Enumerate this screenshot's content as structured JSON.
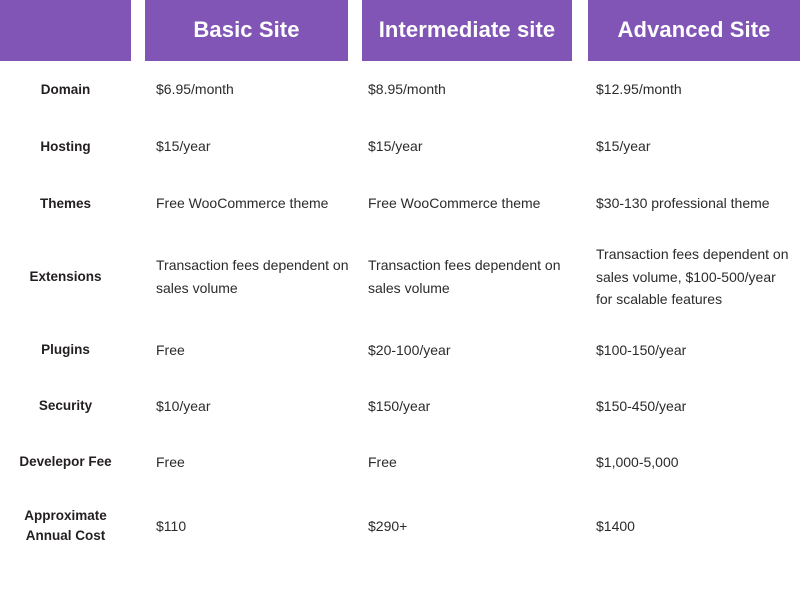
{
  "table": {
    "accent_color": "#8055b5",
    "header_text_color": "#ffffff",
    "body_text_color": "#2b2b2b",
    "columns": [
      {
        "label": ""
      },
      {
        "label": "Basic Site"
      },
      {
        "label": "Intermediate site"
      },
      {
        "label": "Advanced Site"
      }
    ],
    "rows": [
      {
        "label": "Domain",
        "values": [
          "$6.95/month",
          "$8.95/month",
          "$12.95/month"
        ]
      },
      {
        "label": "Hosting",
        "values": [
          "$15/year",
          "$15/year",
          "$15/year"
        ]
      },
      {
        "label": "Themes",
        "values": [
          "Free WooCommerce theme",
          "Free WooCommerce theme",
          "$30-130 professional theme"
        ]
      },
      {
        "label": "Extensions",
        "values": [
          "Transaction fees dependent on sales volume",
          "Transaction fees dependent on sales volume",
          "Transaction fees dependent on sales volume, $100-500/year for scalable features"
        ]
      },
      {
        "label": "Plugins",
        "values": [
          "Free",
          "$20-100/year",
          "$100-150/year"
        ]
      },
      {
        "label": "Security",
        "values": [
          "$10/year",
          "$150/year",
          "$150-450/year"
        ]
      },
      {
        "label": "Develepor Fee",
        "values": [
          "Free",
          "Free",
          "$1,000-5,000"
        ]
      },
      {
        "label": "Approximate Annual Cost",
        "values": [
          "$110",
          "$290+",
          "$1400"
        ]
      }
    ]
  }
}
